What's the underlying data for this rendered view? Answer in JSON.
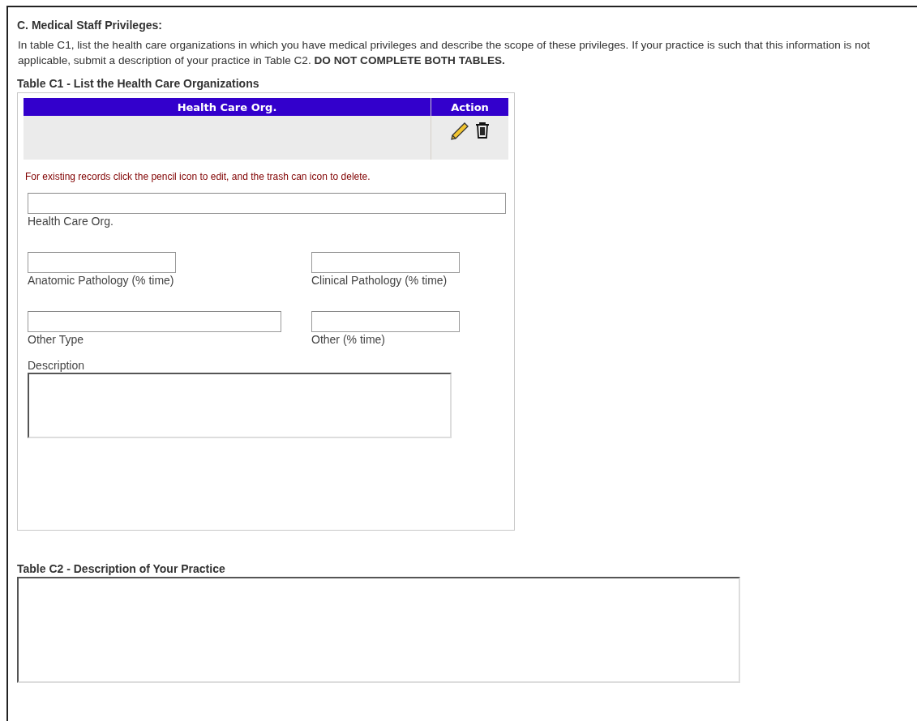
{
  "section_title": "C. Medical Staff Privileges:",
  "instructions": "In table C1, list the health care organizations in which you have medical privileges and describe the scope of these privileges. If your practice is such that this information is not applicable, submit a description of your practice in Table C2. **DO NOT COMPLETE BOTH TABLES.**",
  "table_c1": {
    "title": "Table C1 - List the Health Care Organizations",
    "columns": [
      "Health Care Org.",
      "Action"
    ],
    "rows": [
      {
        "kind": "record"
      }
    ],
    "note": "For existing records click the pencil icon to edit, and the trash can icon to delete.",
    "field_rows": [
      {
        "fields": [
          {
            "label": "Health Care Org.",
            "kind": "wide"
          }
        ]
      },
      {
        "fields": [
          {
            "label": "Anatomic Pathology (% time)",
            "kind": "short"
          },
          {
            "label": "Clinical Pathology (% time)",
            "kind": "short"
          }
        ]
      },
      {
        "fields": [
          {
            "label": "Other Type",
            "kind": "medium"
          },
          {
            "label": "Other (% time)",
            "kind": "short"
          }
        ]
      },
      {
        "fields": [
          {
            "label": "Description",
            "kind": "textarea"
          }
        ]
      }
    ]
  },
  "table_c2": {
    "title": "Table C2 - Description of Your Practice"
  }
}
